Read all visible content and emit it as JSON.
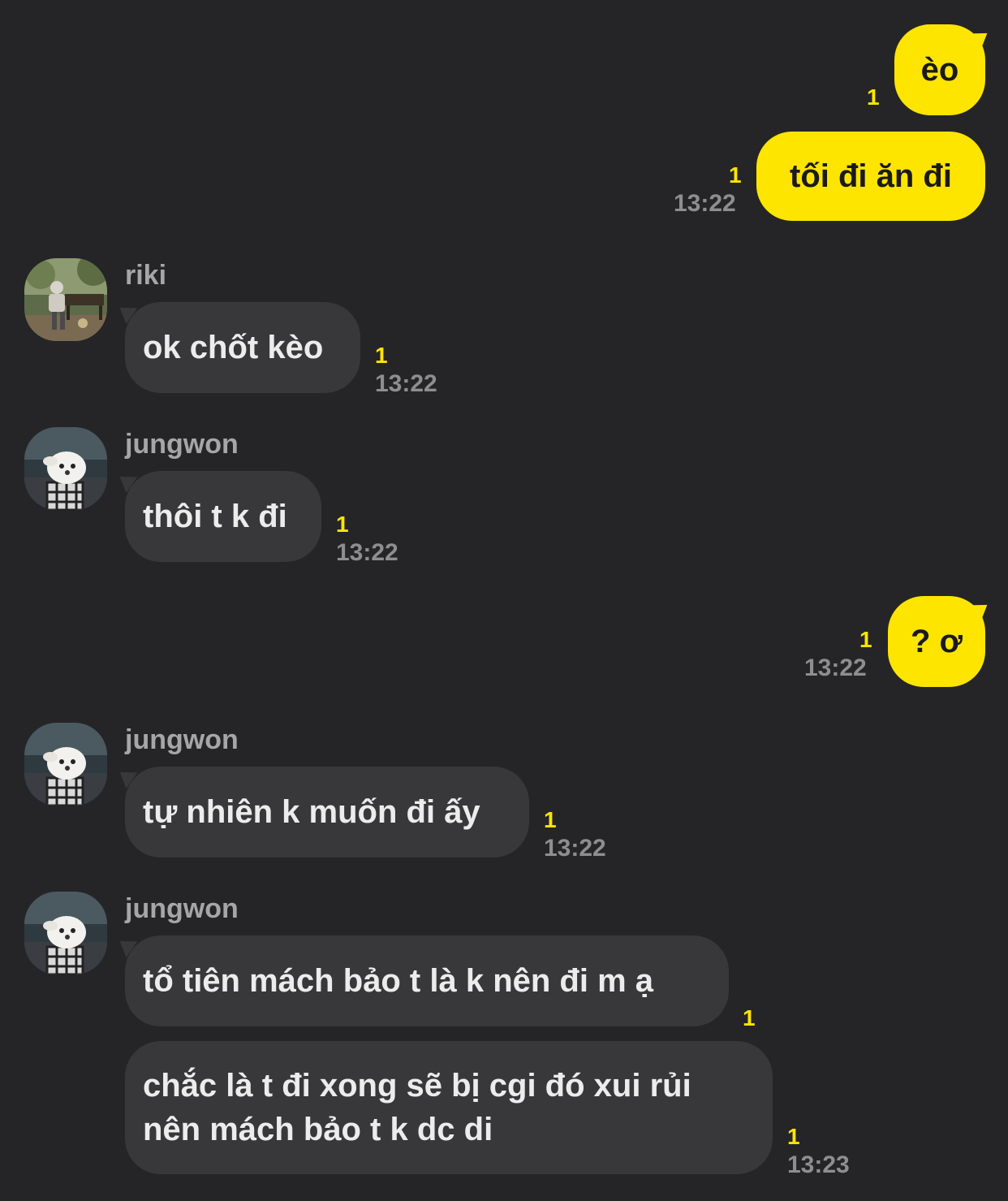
{
  "colors": {
    "background": "#252527",
    "my_bubble": "#fee500",
    "their_bubble": "#38383a",
    "unread_count": "#fee500",
    "timestamp": "#8e8e91"
  },
  "messages": [
    {
      "sender": "me",
      "text": "èo",
      "unread": "1",
      "time": ""
    },
    {
      "sender": "me",
      "text": "tối đi ăn đi",
      "unread": "1",
      "time": "13:22"
    },
    {
      "sender": "riki",
      "text": "ok chốt kèo",
      "unread": "1",
      "time": "13:22"
    },
    {
      "sender": "jungwon",
      "text": "thôi t k đi",
      "unread": "1",
      "time": "13:22"
    },
    {
      "sender": "me",
      "text": "? ơ",
      "unread": "1",
      "time": "13:22"
    },
    {
      "sender": "jungwon",
      "text": "tự nhiên k muốn đi ấy",
      "unread": "1",
      "time": "13:22"
    },
    {
      "sender": "jungwon",
      "text": "tổ tiên mách bảo t là k nên đi m ạ",
      "unread": "1",
      "time": ""
    },
    {
      "sender": "jungwon",
      "text": "chắc là t đi xong sẽ bị cgi đó xui rủi nên mách bảo t k dc di",
      "unread": "1",
      "time": "13:23"
    }
  ],
  "avatars": {
    "riki": "park-bench-photo-avatar",
    "jungwon": "white-dog-photo-avatar"
  }
}
